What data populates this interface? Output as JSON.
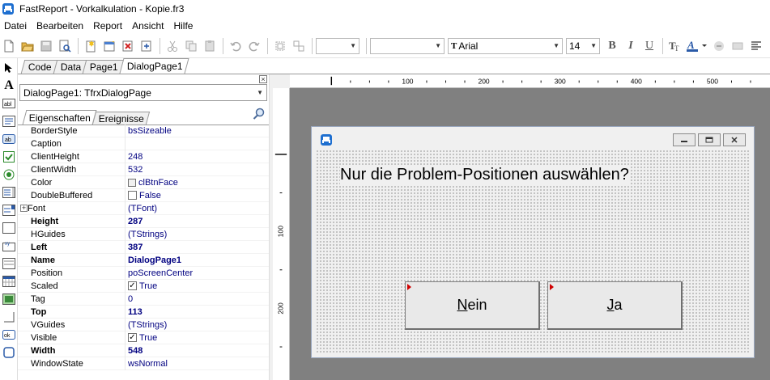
{
  "window": {
    "title": "FastReport - Vorkalkulation - Kopie.fr3"
  },
  "menu": [
    "Datei",
    "Bearbeiten",
    "Report",
    "Ansicht",
    "Hilfe"
  ],
  "toolbar": {
    "style_combo_value": "",
    "object_combo_value": "",
    "font_name": "Arial",
    "font_size": "14",
    "bold_label": "B",
    "italic_label": "I",
    "underline_label": "U"
  },
  "tabs": [
    "Code",
    "Data",
    "Page1",
    "DialogPage1"
  ],
  "inspector": {
    "object_select": "DialogPage1: TfrxDialogPage",
    "tabs": [
      "Eigenschaften",
      "Ereignisse"
    ],
    "properties": [
      {
        "name": "BorderStyle",
        "value": "bsSizeable"
      },
      {
        "name": "Caption",
        "value": ""
      },
      {
        "name": "ClientHeight",
        "value": "248"
      },
      {
        "name": "ClientWidth",
        "value": "532"
      },
      {
        "name": "Color",
        "value": "clBtnFace"
      },
      {
        "name": "DoubleBuffered",
        "value": "False"
      },
      {
        "name": "Font",
        "value": "(TFont)"
      },
      {
        "name": "Height",
        "value": "287"
      },
      {
        "name": "HGuides",
        "value": "(TStrings)"
      },
      {
        "name": "Left",
        "value": "387"
      },
      {
        "name": "Name",
        "value": "DialogPage1"
      },
      {
        "name": "Position",
        "value": "poScreenCenter"
      },
      {
        "name": "Scaled",
        "value": "True"
      },
      {
        "name": "Tag",
        "value": "0"
      },
      {
        "name": "Top",
        "value": "113"
      },
      {
        "name": "VGuides",
        "value": "(TStrings)"
      },
      {
        "name": "Visible",
        "value": "True"
      },
      {
        "name": "Width",
        "value": "548"
      },
      {
        "name": "WindowState",
        "value": "wsNormal"
      }
    ]
  },
  "ruler": {
    "h_labels": [
      "100",
      "200",
      "300",
      "400",
      "500"
    ],
    "v_labels": [
      "100",
      "200"
    ]
  },
  "dialog": {
    "question": "Nur die Problem-Positionen auswählen?",
    "button_no": {
      "accel": "N",
      "rest": "ein"
    },
    "button_yes": {
      "accel": "J",
      "rest": "a"
    }
  },
  "colors": {
    "workspace": "#808080",
    "dialog_face": "#f0f0f0",
    "property_value": "#000080",
    "marker": "#d00000"
  }
}
